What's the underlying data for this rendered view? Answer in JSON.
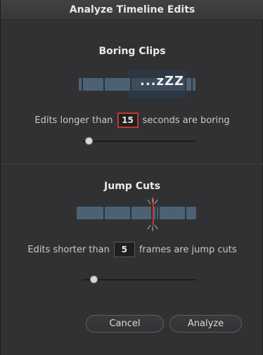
{
  "dialog": {
    "title": "Analyze Timeline Edits"
  },
  "boring_clips": {
    "title": "Boring Clips",
    "zzz_text": "...zZZ",
    "label_before": "Edits longer than",
    "value": "15",
    "label_after": "seconds are boring",
    "slider_level": 0.06
  },
  "jump_cuts": {
    "title": "Jump Cuts",
    "label_before": "Edits shorter than",
    "value": "5",
    "label_after": "frames are jump cuts",
    "slider_level": 0.1
  },
  "buttons": {
    "cancel": "Cancel",
    "analyze": "Analyze"
  },
  "colors": {
    "clip": "#4d6173",
    "highlight": "#2c3944",
    "active_field": "#c4352f",
    "cut_marker": "#d2322c"
  }
}
